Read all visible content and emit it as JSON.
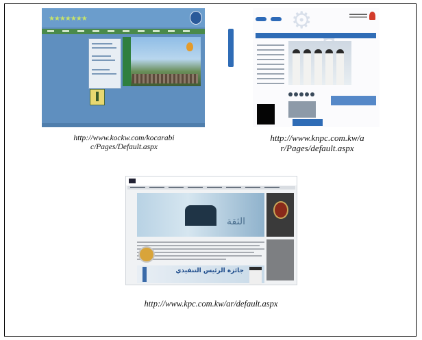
{
  "page": {
    "background": "#ffffff",
    "border_color": "#000000"
  },
  "screenshots": [
    {
      "id": "koc",
      "caption_lines": [
        "http://www.kockw.com/kocarabi",
        "c/Pages/Default.aspx"
      ],
      "theme_color": "#5f8fbf"
    },
    {
      "id": "knpc",
      "caption_lines": [
        "http://www.knpc.com.kw/a",
        "r/Pages/default.aspx"
      ],
      "theme_color": "#2f6cb6"
    },
    {
      "id": "kpc",
      "caption_lines": [
        "http://www.kpc.com.kw/ar/default.aspx"
      ],
      "theme_color": "#3a3a3a"
    }
  ],
  "kpc_banner_word": "الثقة",
  "kpc_ad_word": "جائزة الرئيس التنفيذي"
}
